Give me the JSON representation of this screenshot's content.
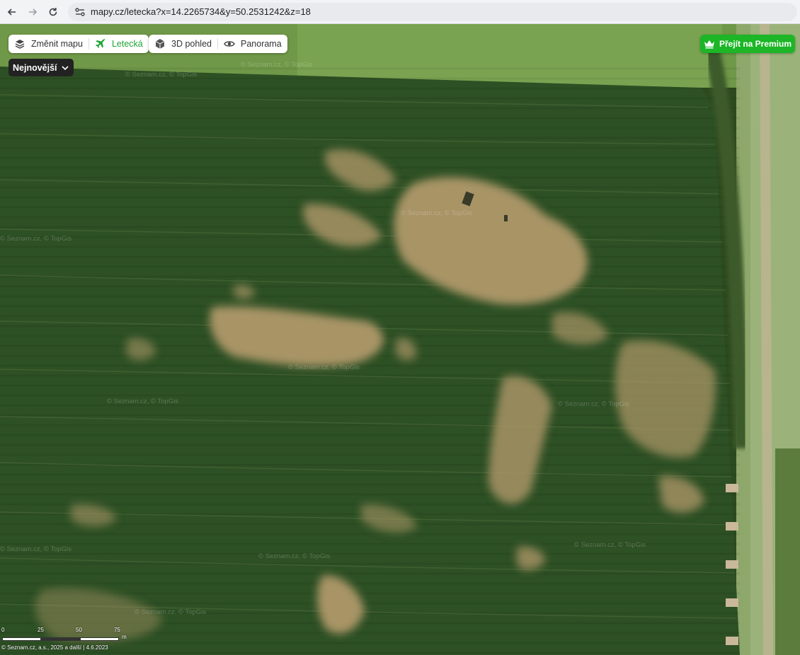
{
  "browser": {
    "url": "mapy.cz/letecka?x=14.2265734&y=50.2531242&z=18"
  },
  "toolbar": {
    "change_map_label": "Změnit mapu",
    "aerial_label": "Letecká",
    "view3d_label": "3D pohled",
    "panorama_label": "Panorama",
    "imagery_dropdown_label": "Nejnovější",
    "premium_label": "Přejít na Premium"
  },
  "map": {
    "watermark_text": "© Seznam.cz, © TopGis",
    "scale": {
      "labels": [
        "0",
        "25",
        "50",
        "75"
      ],
      "unit": "m"
    },
    "copyright": "© Seznam.cz, a.s., 2025 a další | 4.6.2023"
  },
  "colors": {
    "active_green": "#1fa333",
    "premium_green": "#1cb626"
  }
}
